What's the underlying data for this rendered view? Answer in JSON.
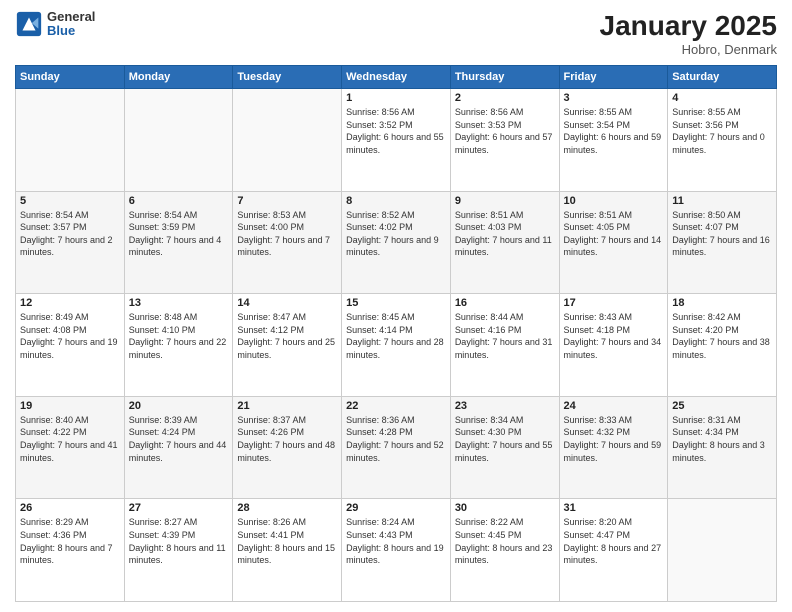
{
  "header": {
    "logo": {
      "general": "General",
      "blue": "Blue"
    },
    "title": "January 2025",
    "location": "Hobro, Denmark"
  },
  "days_of_week": [
    "Sunday",
    "Monday",
    "Tuesday",
    "Wednesday",
    "Thursday",
    "Friday",
    "Saturday"
  ],
  "weeks": [
    [
      {
        "day": "",
        "sunrise": "",
        "sunset": "",
        "daylight": ""
      },
      {
        "day": "",
        "sunrise": "",
        "sunset": "",
        "daylight": ""
      },
      {
        "day": "",
        "sunrise": "",
        "sunset": "",
        "daylight": ""
      },
      {
        "day": "1",
        "sunrise": "Sunrise: 8:56 AM",
        "sunset": "Sunset: 3:52 PM",
        "daylight": "Daylight: 6 hours and 55 minutes."
      },
      {
        "day": "2",
        "sunrise": "Sunrise: 8:56 AM",
        "sunset": "Sunset: 3:53 PM",
        "daylight": "Daylight: 6 hours and 57 minutes."
      },
      {
        "day": "3",
        "sunrise": "Sunrise: 8:55 AM",
        "sunset": "Sunset: 3:54 PM",
        "daylight": "Daylight: 6 hours and 59 minutes."
      },
      {
        "day": "4",
        "sunrise": "Sunrise: 8:55 AM",
        "sunset": "Sunset: 3:56 PM",
        "daylight": "Daylight: 7 hours and 0 minutes."
      }
    ],
    [
      {
        "day": "5",
        "sunrise": "Sunrise: 8:54 AM",
        "sunset": "Sunset: 3:57 PM",
        "daylight": "Daylight: 7 hours and 2 minutes."
      },
      {
        "day": "6",
        "sunrise": "Sunrise: 8:54 AM",
        "sunset": "Sunset: 3:59 PM",
        "daylight": "Daylight: 7 hours and 4 minutes."
      },
      {
        "day": "7",
        "sunrise": "Sunrise: 8:53 AM",
        "sunset": "Sunset: 4:00 PM",
        "daylight": "Daylight: 7 hours and 7 minutes."
      },
      {
        "day": "8",
        "sunrise": "Sunrise: 8:52 AM",
        "sunset": "Sunset: 4:02 PM",
        "daylight": "Daylight: 7 hours and 9 minutes."
      },
      {
        "day": "9",
        "sunrise": "Sunrise: 8:51 AM",
        "sunset": "Sunset: 4:03 PM",
        "daylight": "Daylight: 7 hours and 11 minutes."
      },
      {
        "day": "10",
        "sunrise": "Sunrise: 8:51 AM",
        "sunset": "Sunset: 4:05 PM",
        "daylight": "Daylight: 7 hours and 14 minutes."
      },
      {
        "day": "11",
        "sunrise": "Sunrise: 8:50 AM",
        "sunset": "Sunset: 4:07 PM",
        "daylight": "Daylight: 7 hours and 16 minutes."
      }
    ],
    [
      {
        "day": "12",
        "sunrise": "Sunrise: 8:49 AM",
        "sunset": "Sunset: 4:08 PM",
        "daylight": "Daylight: 7 hours and 19 minutes."
      },
      {
        "day": "13",
        "sunrise": "Sunrise: 8:48 AM",
        "sunset": "Sunset: 4:10 PM",
        "daylight": "Daylight: 7 hours and 22 minutes."
      },
      {
        "day": "14",
        "sunrise": "Sunrise: 8:47 AM",
        "sunset": "Sunset: 4:12 PM",
        "daylight": "Daylight: 7 hours and 25 minutes."
      },
      {
        "day": "15",
        "sunrise": "Sunrise: 8:45 AM",
        "sunset": "Sunset: 4:14 PM",
        "daylight": "Daylight: 7 hours and 28 minutes."
      },
      {
        "day": "16",
        "sunrise": "Sunrise: 8:44 AM",
        "sunset": "Sunset: 4:16 PM",
        "daylight": "Daylight: 7 hours and 31 minutes."
      },
      {
        "day": "17",
        "sunrise": "Sunrise: 8:43 AM",
        "sunset": "Sunset: 4:18 PM",
        "daylight": "Daylight: 7 hours and 34 minutes."
      },
      {
        "day": "18",
        "sunrise": "Sunrise: 8:42 AM",
        "sunset": "Sunset: 4:20 PM",
        "daylight": "Daylight: 7 hours and 38 minutes."
      }
    ],
    [
      {
        "day": "19",
        "sunrise": "Sunrise: 8:40 AM",
        "sunset": "Sunset: 4:22 PM",
        "daylight": "Daylight: 7 hours and 41 minutes."
      },
      {
        "day": "20",
        "sunrise": "Sunrise: 8:39 AM",
        "sunset": "Sunset: 4:24 PM",
        "daylight": "Daylight: 7 hours and 44 minutes."
      },
      {
        "day": "21",
        "sunrise": "Sunrise: 8:37 AM",
        "sunset": "Sunset: 4:26 PM",
        "daylight": "Daylight: 7 hours and 48 minutes."
      },
      {
        "day": "22",
        "sunrise": "Sunrise: 8:36 AM",
        "sunset": "Sunset: 4:28 PM",
        "daylight": "Daylight: 7 hours and 52 minutes."
      },
      {
        "day": "23",
        "sunrise": "Sunrise: 8:34 AM",
        "sunset": "Sunset: 4:30 PM",
        "daylight": "Daylight: 7 hours and 55 minutes."
      },
      {
        "day": "24",
        "sunrise": "Sunrise: 8:33 AM",
        "sunset": "Sunset: 4:32 PM",
        "daylight": "Daylight: 7 hours and 59 minutes."
      },
      {
        "day": "25",
        "sunrise": "Sunrise: 8:31 AM",
        "sunset": "Sunset: 4:34 PM",
        "daylight": "Daylight: 8 hours and 3 minutes."
      }
    ],
    [
      {
        "day": "26",
        "sunrise": "Sunrise: 8:29 AM",
        "sunset": "Sunset: 4:36 PM",
        "daylight": "Daylight: 8 hours and 7 minutes."
      },
      {
        "day": "27",
        "sunrise": "Sunrise: 8:27 AM",
        "sunset": "Sunset: 4:39 PM",
        "daylight": "Daylight: 8 hours and 11 minutes."
      },
      {
        "day": "28",
        "sunrise": "Sunrise: 8:26 AM",
        "sunset": "Sunset: 4:41 PM",
        "daylight": "Daylight: 8 hours and 15 minutes."
      },
      {
        "day": "29",
        "sunrise": "Sunrise: 8:24 AM",
        "sunset": "Sunset: 4:43 PM",
        "daylight": "Daylight: 8 hours and 19 minutes."
      },
      {
        "day": "30",
        "sunrise": "Sunrise: 8:22 AM",
        "sunset": "Sunset: 4:45 PM",
        "daylight": "Daylight: 8 hours and 23 minutes."
      },
      {
        "day": "31",
        "sunrise": "Sunrise: 8:20 AM",
        "sunset": "Sunset: 4:47 PM",
        "daylight": "Daylight: 8 hours and 27 minutes."
      },
      {
        "day": "",
        "sunrise": "",
        "sunset": "",
        "daylight": ""
      }
    ]
  ]
}
